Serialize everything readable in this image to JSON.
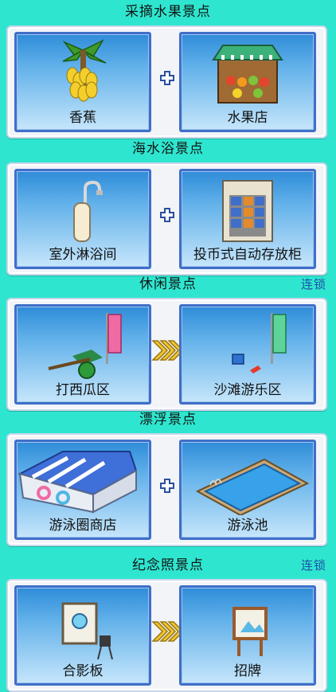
{
  "sections": [
    {
      "title": "采摘水果景点",
      "link": "",
      "connector": "plus-icon",
      "left": {
        "label": "香蕉",
        "icon": "banana-tree-icon"
      },
      "right": {
        "label": "水果店",
        "icon": "fruit-stand-icon"
      }
    },
    {
      "title": "海水浴景点",
      "link": "",
      "connector": "plus-icon",
      "left": {
        "label": "室外淋浴间",
        "icon": "outdoor-shower-icon"
      },
      "right": {
        "label": "投币式自动存放柜",
        "icon": "coin-locker-icon"
      }
    },
    {
      "title": "休闲景点",
      "link": "连锁",
      "connector": "triple-arrow-icon",
      "left": {
        "label": "打西瓜区",
        "icon": "watermelon-smash-icon"
      },
      "right": {
        "label": "沙滩游乐区",
        "icon": "beach-play-area-icon"
      }
    },
    {
      "title": "漂浮景点",
      "link": "",
      "connector": "plus-icon",
      "left": {
        "label": "游泳圈商店",
        "icon": "swim-ring-shop-icon"
      },
      "right": {
        "label": "游泳池",
        "icon": "swimming-pool-icon"
      }
    },
    {
      "title": "纪念照景点",
      "link": "连锁",
      "connector": "triple-arrow-icon",
      "left": {
        "label": "合影板",
        "icon": "photo-board-icon"
      },
      "right": {
        "label": "招牌",
        "icon": "signboard-icon"
      }
    }
  ],
  "colors": {
    "background": "#2ee6cf",
    "card_border": "#3f6fc9",
    "link": "#1f4fa8",
    "arrow": "#f2c631"
  }
}
